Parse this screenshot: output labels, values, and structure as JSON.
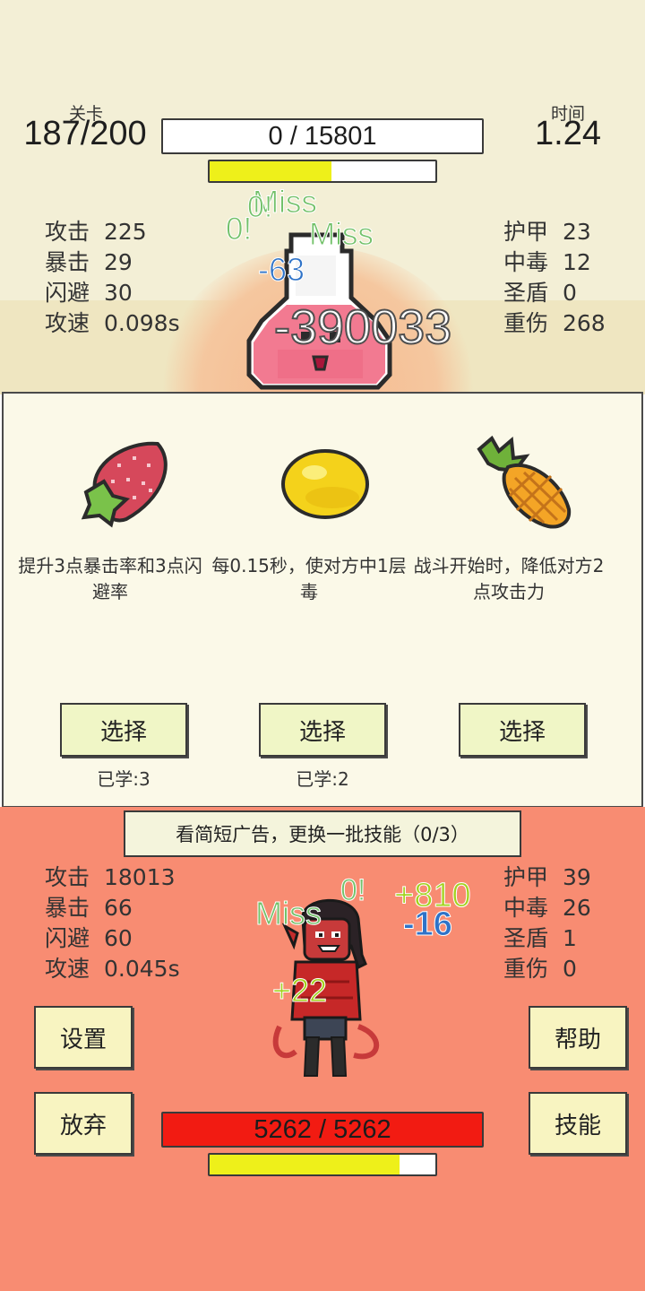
{
  "header": {
    "level_label": "关卡",
    "level_value": "187/200",
    "time_label": "时间",
    "time_value": "1.24",
    "enemy_hp_text": "0 / 15801",
    "enemy_hp_fraction": 0,
    "enemy_energy_fraction": 0.54
  },
  "enemy_stats": {
    "left": [
      {
        "name": "攻击",
        "value": "225"
      },
      {
        "name": "暴击",
        "value": "29"
      },
      {
        "name": "闪避",
        "value": "30"
      },
      {
        "name": "攻速",
        "value": "0.098s"
      }
    ],
    "right": [
      {
        "name": "护甲",
        "value": "23"
      },
      {
        "name": "中毒",
        "value": "12"
      },
      {
        "name": "圣盾",
        "value": "0"
      },
      {
        "name": "重伤",
        "value": "268"
      }
    ]
  },
  "enemy_floats": {
    "miss1": "Miss",
    "o1": "0!",
    "o2": "0!",
    "miss2": "Miss",
    "dmg_small": "-63",
    "dmg_big": "-390033"
  },
  "skills": [
    {
      "fruit": "strawberry-icon",
      "desc": "提升3点暴击率和3点闪避率",
      "button": "选择",
      "learned": "已学:3"
    },
    {
      "fruit": "lemon-icon",
      "desc": "每0.15秒，使对方中1层毒",
      "button": "选择",
      "learned": "已学:2"
    },
    {
      "fruit": "pineapple-icon",
      "desc": "战斗开始时，降低对方2点攻击力",
      "button": "选择",
      "learned": ""
    }
  ],
  "ad_button": "看简短广告，更换一批技能（0/3）",
  "player_stats": {
    "left": [
      {
        "name": "攻击",
        "value": "18013"
      },
      {
        "name": "暴击",
        "value": "66"
      },
      {
        "name": "闪避",
        "value": "60"
      },
      {
        "name": "攻速",
        "value": "0.045s"
      }
    ],
    "right": [
      {
        "name": "护甲",
        "value": "39"
      },
      {
        "name": "中毒",
        "value": "26"
      },
      {
        "name": "圣盾",
        "value": "1"
      },
      {
        "name": "重伤",
        "value": "0"
      }
    ]
  },
  "player_floats": {
    "miss": "Miss",
    "o": "0!",
    "heal_big": "+810",
    "dmg": "-16",
    "heal_small": "+22"
  },
  "buttons": {
    "settings": "设置",
    "give_up": "放弃",
    "help": "帮助",
    "skills": "技能"
  },
  "player_hp_text": "5262 / 5262",
  "player_hp_fraction": 1,
  "player_energy_fraction": 0.84,
  "colors": {
    "hp_red": "#f21b12",
    "energy_yellow": "#eef01a",
    "enemy_bg": "#f3efd6",
    "player_bg": "#f88c72",
    "button_bg": "#f8f4c1"
  }
}
